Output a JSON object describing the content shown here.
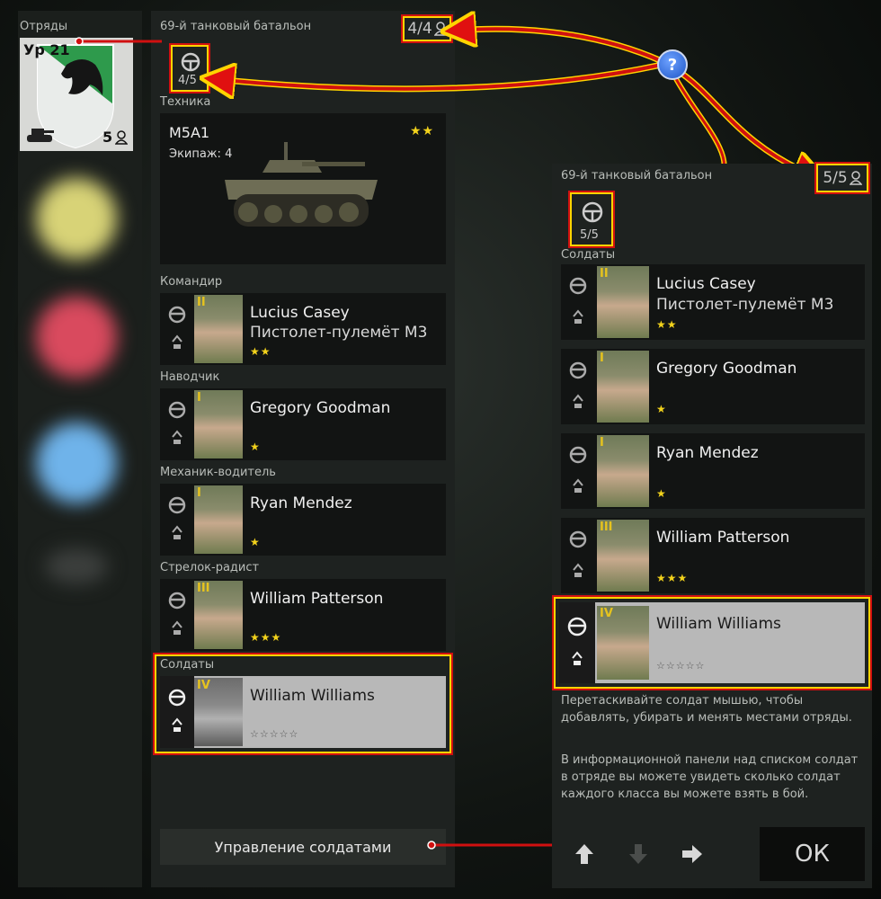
{
  "left": {
    "squads_label": "Отряды",
    "squad_card": {
      "level": "Ур 21",
      "count": "5"
    }
  },
  "mid": {
    "battalion": "69-й танковый батальон",
    "capacity": "4/4",
    "crew_count": "4/5",
    "vehicle_section": "Техника",
    "vehicle": {
      "name": "M5A1",
      "crew_label": "Экипаж: 4",
      "stars": "★★"
    },
    "roles": [
      {
        "role": "Командир",
        "rank": "II",
        "name": "Lucius Casey",
        "weapon": "Пистолет-пулемёт М3",
        "stars": "★★"
      },
      {
        "role": "Наводчик",
        "rank": "I",
        "name": "Gregory Goodman",
        "weapon": "",
        "stars": "★"
      },
      {
        "role": "Механик-водитель",
        "rank": "I",
        "name": "Ryan Mendez",
        "weapon": "",
        "stars": "★"
      },
      {
        "role": "Стрелок-радист",
        "rank": "III",
        "name": "William Patterson",
        "weapon": "",
        "stars": "★★★"
      }
    ],
    "soldiers_label": "Солдаты",
    "selected": {
      "rank": "IV",
      "name": "William Williams",
      "stars": "☆☆☆☆☆"
    },
    "manage_button": "Управление солдатами"
  },
  "help": "?",
  "right": {
    "battalion": "69-й танковый батальон",
    "capacity": "5/5",
    "crew_count": "5/5",
    "soldiers_label": "Солдаты",
    "soldiers": [
      {
        "rank": "II",
        "name": "Lucius Casey",
        "weapon": "Пистолет-пулемёт М3",
        "stars": "★★"
      },
      {
        "rank": "I",
        "name": "Gregory Goodman",
        "weapon": "",
        "stars": "★"
      },
      {
        "rank": "I",
        "name": "Ryan Mendez",
        "weapon": "",
        "stars": "★"
      },
      {
        "rank": "III",
        "name": "William Patterson",
        "weapon": "",
        "stars": "★★★"
      }
    ],
    "selected": {
      "rank": "IV",
      "name": "William Williams",
      "stars": "☆☆☆☆☆"
    },
    "hint1": "Перетаскивайте солдат мышью, чтобы добавлять, убирать и менять местами отряды.",
    "hint2": "В информационной панели над списком солдат в отряде вы можете увидеть сколько солдат каждого класса вы можете взять в бой.",
    "ok_button": "ОК"
  },
  "colors": {
    "highlight_yellow": "#ffd400",
    "highlight_red": "#d01010",
    "star": "#f2d21c",
    "rank": "#e6c31e"
  }
}
